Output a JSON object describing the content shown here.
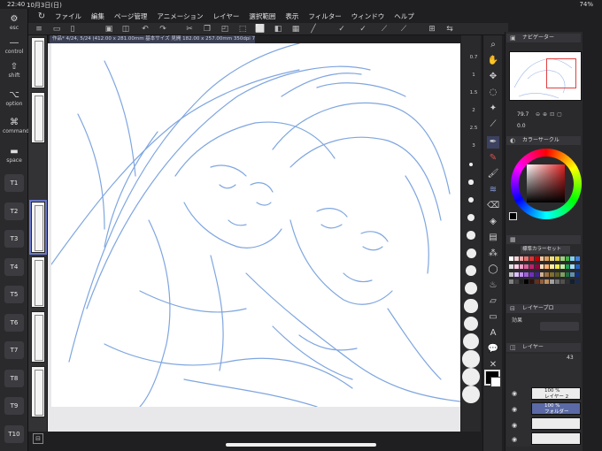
{
  "status": {
    "time": "22:40",
    "date": "10月3日(日)",
    "battery": "74%"
  },
  "menu": [
    "ファイル",
    "編集",
    "ページ管理",
    "アニメーション",
    "レイヤー",
    "選択範囲",
    "表示",
    "フィルター",
    "ウィンドウ",
    "ヘルプ"
  ],
  "left_keys": {
    "esc": "esc",
    "control": "control",
    "shift": "shift",
    "option": "option",
    "command": "command",
    "space": "space",
    "t": [
      "T1",
      "T2",
      "T3",
      "T4",
      "T5",
      "T6",
      "T7",
      "T8",
      "T9",
      "T10"
    ]
  },
  "document": {
    "tab": "作品* 4/24, 5/24 (412.00 x 281.00mm 基本サイズ 見開 182.00 x 257.00mm 350dpi 79.7%)"
  },
  "brush_sizes": [
    "0.7",
    "1",
    "1.5",
    "2",
    "2.5",
    "3",
    "4",
    "5",
    "6",
    "7",
    "8",
    "10",
    "12",
    "15",
    "17",
    "20",
    "25",
    "30",
    "40",
    "50"
  ],
  "panels": {
    "navigator": {
      "title": "ナビゲーター",
      "zoom": "79.7",
      "rotation": "0.0"
    },
    "color_circle": {
      "title": "カラーサークル",
      "foreground": "#000000",
      "background": "#ffffff"
    },
    "color_set": {
      "name": "標準カラーセット"
    },
    "layer_property": {
      "title": "レイヤープロ",
      "effect": "効果"
    },
    "layers": {
      "title": "レイヤー",
      "opacity": "43",
      "items": [
        {
          "label": "100 %",
          "name": "レイヤー 2"
        },
        {
          "label": "100 %",
          "name": "フォルダー"
        },
        {
          "label": "",
          "name": ""
        },
        {
          "label": "",
          "name": ""
        }
      ]
    }
  },
  "colors": {
    "accent": "#5b6aa6",
    "sketch": "#7fa6e0",
    "nav_rect": "#e04040"
  },
  "swatches": [
    "#ffffff",
    "#f4d0d0",
    "#f0a8a8",
    "#e87070",
    "#e03030",
    "#c00000",
    "#f0c8a0",
    "#e0a060",
    "#f0e080",
    "#e0d040",
    "#a0d080",
    "#40b040",
    "#80d0f0",
    "#4080e0",
    "#e0e0e0",
    "#ffd0e8",
    "#f0a0c8",
    "#e060a0",
    "#c02070",
    "#900040",
    "#ffe0c0",
    "#ffb070",
    "#fff0a0",
    "#f0f050",
    "#c0f0a0",
    "#20a050",
    "#a0e0ff",
    "#2060c0",
    "#c0c0c0",
    "#e0c0ff",
    "#c090f0",
    "#a060e0",
    "#7030c0",
    "#402090",
    "#d0b090",
    "#a07040",
    "#807030",
    "#606020",
    "#80a060",
    "#207040",
    "#6090b0",
    "#103080",
    "#808080",
    "#404040",
    "#202020",
    "#000000",
    "#301010",
    "#603020",
    "#906040",
    "#c09060",
    "#a0a0a0",
    "#707070",
    "#505050",
    "#303030",
    "#102030",
    "#1c2a4a"
  ],
  "tools": [
    "magnifier-icon",
    "hand-icon",
    "move-icon",
    "lasso-icon",
    "wand-icon",
    "eyedropper-icon",
    "pen-icon",
    "pencil-icon",
    "brush-icon",
    "airbrush-icon",
    "decoration-icon",
    "eraser-icon",
    "fill-icon",
    "gradient-icon",
    "figure-icon",
    "frame-icon",
    "text-icon",
    "balloon-icon",
    "line-correction-icon"
  ]
}
